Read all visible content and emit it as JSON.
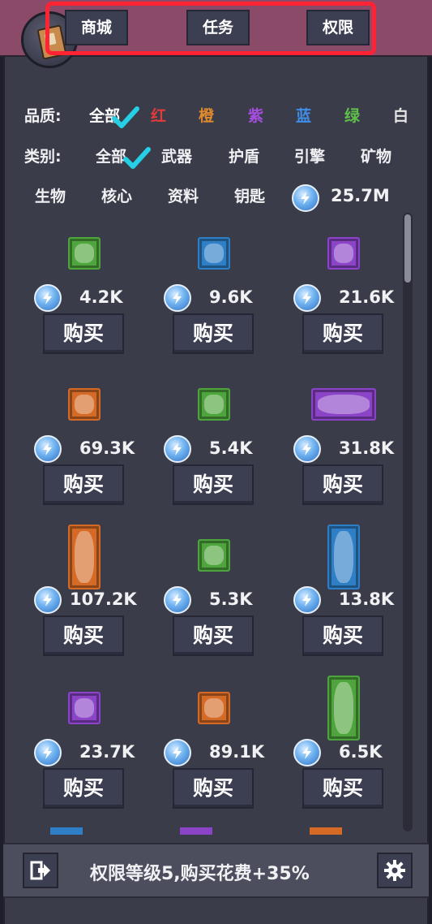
{
  "tabs": [
    {
      "label": "商城"
    },
    {
      "label": "任务"
    },
    {
      "label": "权限"
    }
  ],
  "quality_filter": {
    "label": "品质:",
    "options": [
      {
        "label": "全部",
        "color": "#ffffff",
        "selected": true
      },
      {
        "label": "红",
        "color": "#e23b3b"
      },
      {
        "label": "橙",
        "color": "#e08a2c"
      },
      {
        "label": "紫",
        "color": "#a64ee0"
      },
      {
        "label": "蓝",
        "color": "#3f8ee8"
      },
      {
        "label": "绿",
        "color": "#5fc04a"
      },
      {
        "label": "白",
        "color": "#e6e6e6"
      }
    ]
  },
  "category_filter": {
    "label": "类别:",
    "options": [
      {
        "label": "全部",
        "selected": true
      },
      {
        "label": "武器"
      },
      {
        "label": "护盾"
      },
      {
        "label": "引擎"
      },
      {
        "label": "矿物"
      },
      {
        "label": "生物"
      },
      {
        "label": "核心"
      },
      {
        "label": "资料"
      },
      {
        "label": "钥匙"
      }
    ]
  },
  "currency": {
    "icon": "energy-shard-icon",
    "total": "25.7M"
  },
  "shop_items": [
    {
      "icon": "green-crystal-icon",
      "rarity_color": "#4fa53d",
      "price": "4.2K",
      "buy_label": "购买"
    },
    {
      "icon": "blue-orb-icon",
      "rarity_color": "#2f7fc6",
      "price": "9.6K",
      "buy_label": "购买"
    },
    {
      "icon": "purple-key-icon",
      "rarity_color": "#8b44c7",
      "price": "21.6K",
      "buy_label": "购买"
    },
    {
      "icon": "orange-spore-icon",
      "rarity_color": "#d56a26",
      "price": "69.3K",
      "buy_label": "购买"
    },
    {
      "icon": "grey-ore-icon",
      "rarity_color": "#4fa53d",
      "price": "5.4K",
      "buy_label": "购买"
    },
    {
      "icon": "purple-rock-icon",
      "rarity_color": "#8b44c7",
      "price": "31.8K",
      "buy_label": "购买"
    },
    {
      "icon": "metal-plate-icon",
      "rarity_color": "#d56a26",
      "price": "107.2K",
      "buy_label": "购买"
    },
    {
      "icon": "data-scroll-icon",
      "rarity_color": "#4fa53d",
      "price": "5.3K",
      "buy_label": "购买"
    },
    {
      "icon": "robot-turret-icon",
      "rarity_color": "#2f7fc6",
      "price": "13.8K",
      "buy_label": "购买"
    },
    {
      "icon": "pink-device-icon",
      "rarity_color": "#8b44c7",
      "price": "23.7K",
      "buy_label": "购买"
    },
    {
      "icon": "layer-core-icon",
      "rarity_color": "#d56a26",
      "price": "89.1K",
      "buy_label": "购买"
    },
    {
      "icon": "dna-capsule-icon",
      "rarity_color": "#4fa53d",
      "price": "6.5K",
      "buy_label": "购买"
    }
  ],
  "status": {
    "text": "权限等级5,购买花费+35%"
  },
  "bottom": {
    "exit_icon": "exit-icon",
    "settings_icon": "gear-icon"
  }
}
